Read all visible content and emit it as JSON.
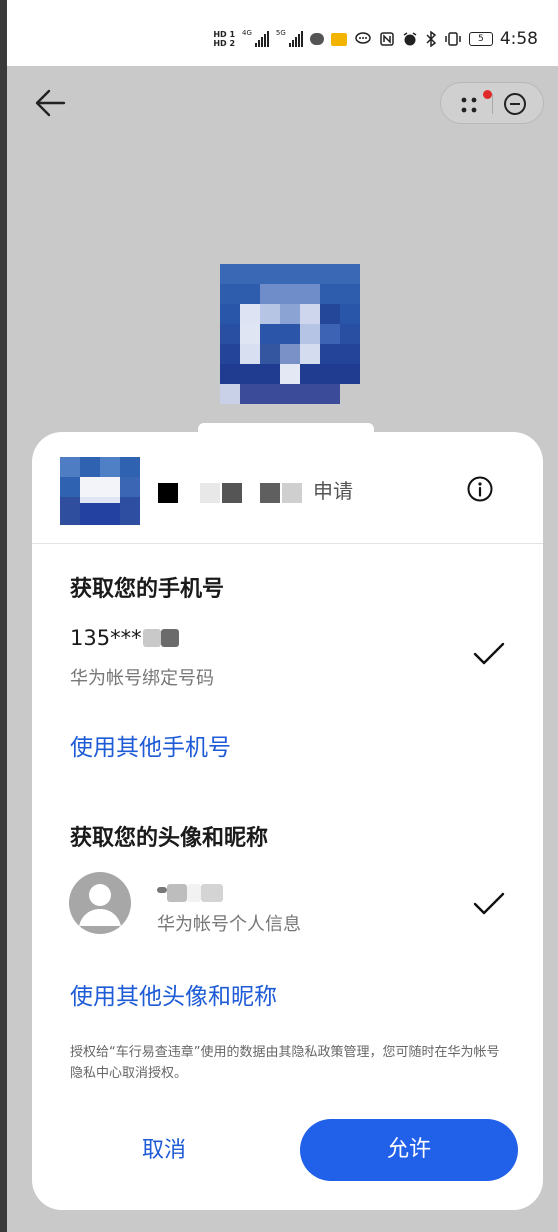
{
  "statusbar": {
    "hd_top": "HD 1",
    "hd_bottom": "HD 2",
    "net1": "4G",
    "net2": "5G",
    "battery": "5",
    "time": "4:58"
  },
  "topbar": {
    "back_icon": "arrow-left-icon",
    "more_icon": "more-dots-icon",
    "close_icon": "minus-circle-icon"
  },
  "sheet": {
    "apply_text": "申请",
    "info_icon": "info-icon",
    "phone_section": {
      "title": "获取您的手机号",
      "number_prefix": "135***",
      "source": "华为帐号绑定号码",
      "other_link": "使用其他手机号"
    },
    "profile_section": {
      "title": "获取您的头像和昵称",
      "source": "华为帐号个人信息",
      "other_link": "使用其他头像和昵称"
    },
    "notice": "授权给“车行易查违章”使用的数据由其隐私政策管理，您可随时在华为帐号隐私中心取消授权。",
    "cancel_label": "取消",
    "allow_label": "允许"
  },
  "colors": {
    "accent": "#2160e8",
    "link": "#1e5bd6",
    "notification_dot": "#e02a2a"
  }
}
